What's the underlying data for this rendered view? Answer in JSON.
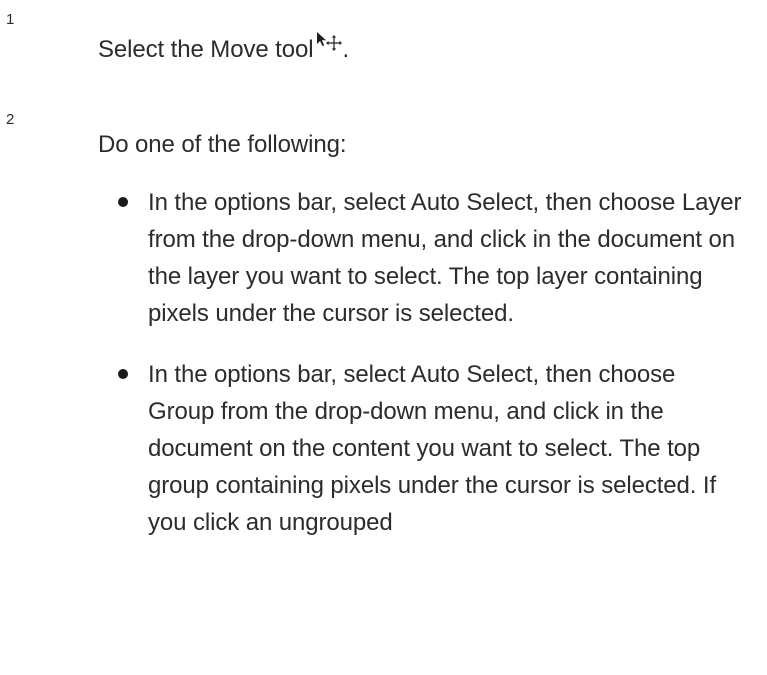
{
  "steps": [
    {
      "number": "1",
      "text": "Select the Move tool",
      "text_suffix": ".",
      "icon": "move-tool-icon"
    },
    {
      "number": "2",
      "text": "Do one of the following:",
      "bullets": [
        {
          "text": "In the options bar, select Auto Select, then choose Layer from the drop-down menu, and click in the document on the layer you want to select. The top layer containing pixels under the cursor is selected."
        },
        {
          "text": "In the options bar, select Auto Select, then choose Group from the drop-down menu, and click in the document on the content you want to select. The top group containing pixels under the cursor is selected. If you click an ungrouped"
        }
      ]
    }
  ]
}
